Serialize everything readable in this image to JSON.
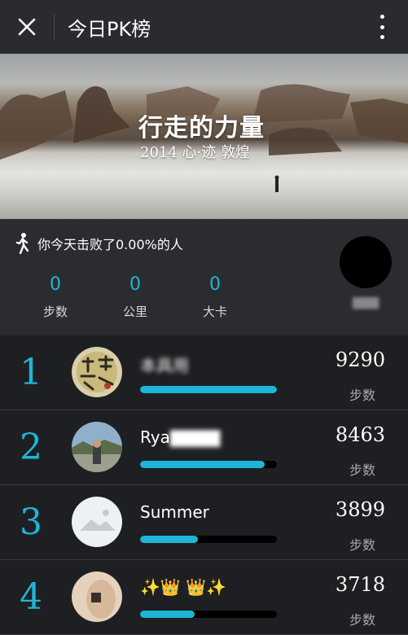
{
  "header": {
    "title": "今日PK榜"
  },
  "banner": {
    "title": "行走的力量",
    "subtitle": "2014 心·迹 敦煌"
  },
  "summary": {
    "beat_text": "你今天击败了0.00%的人",
    "stats": [
      {
        "value": "0",
        "label": "步数"
      },
      {
        "value": "0",
        "label": "公里"
      },
      {
        "value": "0",
        "label": "大卡"
      }
    ]
  },
  "ranking": [
    {
      "rank": "1",
      "name": "本具用",
      "steps": "9290",
      "unit": "步数",
      "progress": 1.0,
      "avatar": "calligraphy-avatar"
    },
    {
      "rank": "2",
      "name": "Rya",
      "steps": "8463",
      "unit": "步数",
      "progress": 0.91,
      "avatar": "landscape-avatar"
    },
    {
      "rank": "3",
      "name": "Summer",
      "steps": "3899",
      "unit": "步数",
      "progress": 0.42,
      "avatar": "default-avatar"
    },
    {
      "rank": "4",
      "name": "✨👑 👑✨",
      "steps": "3718",
      "unit": "步数",
      "progress": 0.4,
      "avatar": "photo-avatar"
    }
  ],
  "colors": {
    "accent": "#1fb5d6",
    "background": "#1e1f22",
    "topbar": "#2a2b2e"
  }
}
